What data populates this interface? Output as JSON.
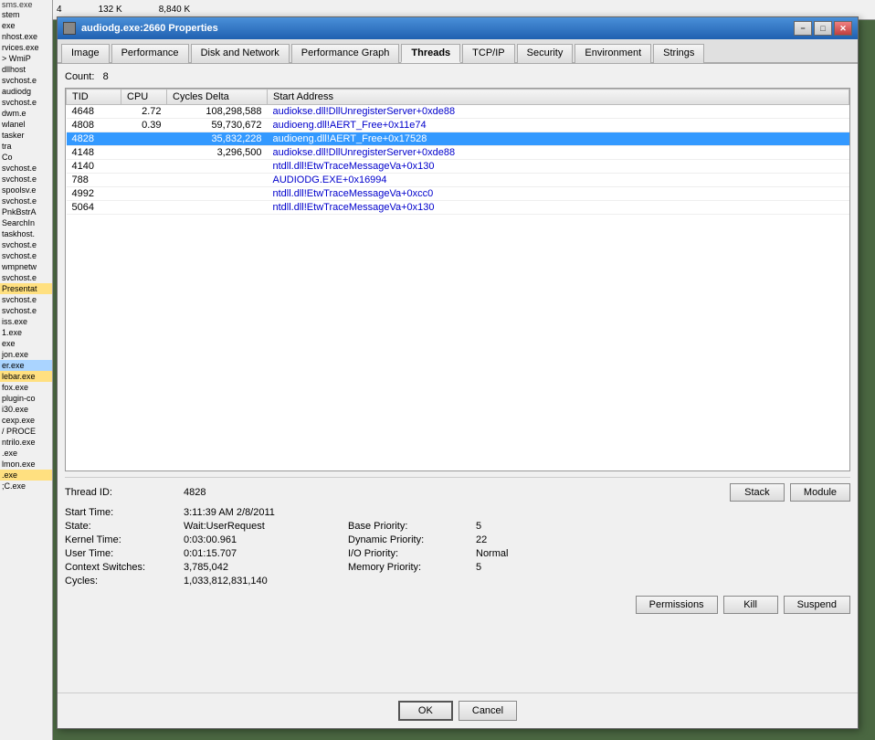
{
  "sidebar": {
    "items": [
      {
        "label": "sms.exe",
        "highlight": "none"
      },
      {
        "label": "stem",
        "highlight": "none"
      },
      {
        "label": "exe",
        "highlight": "none"
      },
      {
        "label": "nhost.exe",
        "highlight": "none"
      },
      {
        "label": "rvices.exe",
        "highlight": "none"
      },
      {
        "label": "> WmiP",
        "highlight": "none"
      },
      {
        "label": "dllhost",
        "highlight": "none"
      },
      {
        "label": "svchost.e",
        "highlight": "none"
      },
      {
        "label": "audiodg",
        "highlight": "none"
      },
      {
        "label": "svchost.e",
        "highlight": "none"
      },
      {
        "label": "dwm.e",
        "highlight": "none"
      },
      {
        "label": "wlanel",
        "highlight": "none"
      },
      {
        "label": "tasker",
        "highlight": "none"
      },
      {
        "label": "tra",
        "highlight": "none"
      },
      {
        "label": "Co",
        "highlight": "none"
      },
      {
        "label": "svchost.e",
        "highlight": "none"
      },
      {
        "label": "svchost.e",
        "highlight": "none"
      },
      {
        "label": "spoolsv.e",
        "highlight": "none"
      },
      {
        "label": "svchost.e",
        "highlight": "none"
      },
      {
        "label": "PnkBstrA",
        "highlight": "none"
      },
      {
        "label": "SearchIn",
        "highlight": "none"
      },
      {
        "label": "taskhost.",
        "highlight": "none"
      },
      {
        "label": "svchost.e",
        "highlight": "none"
      },
      {
        "label": "svchost.e",
        "highlight": "none"
      },
      {
        "label": "wmpnetw",
        "highlight": "none"
      },
      {
        "label": "svchost.e",
        "highlight": "none"
      },
      {
        "label": "Presentat",
        "highlight": "yellow"
      },
      {
        "label": "svchost.e",
        "highlight": "none"
      },
      {
        "label": "svchost.e",
        "highlight": "none"
      },
      {
        "label": "iss.exe",
        "highlight": "none"
      },
      {
        "label": "1.exe",
        "highlight": "none"
      },
      {
        "label": "exe",
        "highlight": "none"
      },
      {
        "label": "jon.exe",
        "highlight": "none"
      },
      {
        "label": "er.exe",
        "highlight": "blue"
      },
      {
        "label": "lebar.exe",
        "highlight": "yellow"
      },
      {
        "label": "fox.exe",
        "highlight": "none"
      },
      {
        "label": "plugin-co",
        "highlight": "none"
      },
      {
        "label": "i30.exe",
        "highlight": "none"
      },
      {
        "label": "cexp.exe",
        "highlight": "none"
      },
      {
        "label": "/ PROCE",
        "highlight": "none"
      },
      {
        "label": "ntrilo.exe",
        "highlight": "none"
      },
      {
        "label": ".exe",
        "highlight": "none"
      },
      {
        "label": "lmon.exe",
        "highlight": "none"
      },
      {
        "label": ".exe",
        "highlight": "yellow"
      },
      {
        "label": ";C.exe",
        "highlight": "none"
      }
    ]
  },
  "topbar": {
    "col1": "4",
    "col2": "132 K",
    "col3": "8,840 K"
  },
  "window": {
    "title": "audiodg.exe:2660 Properties"
  },
  "tabs": [
    {
      "label": "Image",
      "active": false
    },
    {
      "label": "Performance",
      "active": false
    },
    {
      "label": "Disk and Network",
      "active": false
    },
    {
      "label": "Performance Graph",
      "active": false
    },
    {
      "label": "Threads",
      "active": true
    },
    {
      "label": "TCP/IP",
      "active": false
    },
    {
      "label": "Security",
      "active": false
    },
    {
      "label": "Environment",
      "active": false
    },
    {
      "label": "Strings",
      "active": false
    }
  ],
  "thread_count_label": "Count:",
  "thread_count_value": "8",
  "table": {
    "columns": [
      "TID",
      "CPU",
      "Cycles Delta",
      "Start Address"
    ],
    "rows": [
      {
        "tid": "4648",
        "cpu": "2.72",
        "cycles": "108,298,588",
        "address": "audiokse.dll!DllUnregisterServer+0xde88",
        "selected": false
      },
      {
        "tid": "4808",
        "cpu": "0.39",
        "cycles": "59,730,672",
        "address": "audioeng.dll!AERT_Free+0x11e74",
        "selected": false
      },
      {
        "tid": "4828",
        "cpu": "",
        "cycles": "35,832,228",
        "address": "audioeng.dll!AERT_Free+0x17528",
        "selected": true
      },
      {
        "tid": "4148",
        "cpu": "",
        "cycles": "3,296,500",
        "address": "audiokse.dll!DllUnregisterServer+0xde88",
        "selected": false
      },
      {
        "tid": "4140",
        "cpu": "",
        "cycles": "",
        "address": "ntdll.dll!EtwTraceMessageVa+0x130",
        "selected": false
      },
      {
        "tid": "788",
        "cpu": "",
        "cycles": "",
        "address": "AUDIODG.EXE+0x16994",
        "selected": false
      },
      {
        "tid": "4992",
        "cpu": "",
        "cycles": "",
        "address": "ntdll.dll!EtwTraceMessageVa+0xcc0",
        "selected": false
      },
      {
        "tid": "5064",
        "cpu": "",
        "cycles": "",
        "address": "ntdll.dll!EtwTraceMessageVa+0x130",
        "selected": false
      }
    ]
  },
  "detail": {
    "thread_id_label": "Thread ID:",
    "thread_id_value": "4828",
    "stack_btn": "Stack",
    "module_btn": "Module",
    "start_time_label": "Start Time:",
    "start_time_value": "3:11:39 AM  2/8/2011",
    "state_label": "State:",
    "state_value": "Wait:UserRequest",
    "base_priority_label": "Base Priority:",
    "base_priority_value": "5",
    "kernel_time_label": "Kernel Time:",
    "kernel_time_value": "0:03:00.961",
    "dynamic_priority_label": "Dynamic Priority:",
    "dynamic_priority_value": "22",
    "user_time_label": "User Time:",
    "user_time_value": "0:01:15.707",
    "io_priority_label": "I/O Priority:",
    "io_priority_value": "Normal",
    "context_switches_label": "Context Switches:",
    "context_switches_value": "3,785,042",
    "memory_priority_label": "Memory Priority:",
    "memory_priority_value": "5",
    "cycles_label": "Cycles:",
    "cycles_value": "1,033,812,831,140",
    "permissions_btn": "Permissions",
    "kill_btn": "Kill",
    "suspend_btn": "Suspend",
    "ok_btn": "OK",
    "cancel_btn": "Cancel"
  }
}
